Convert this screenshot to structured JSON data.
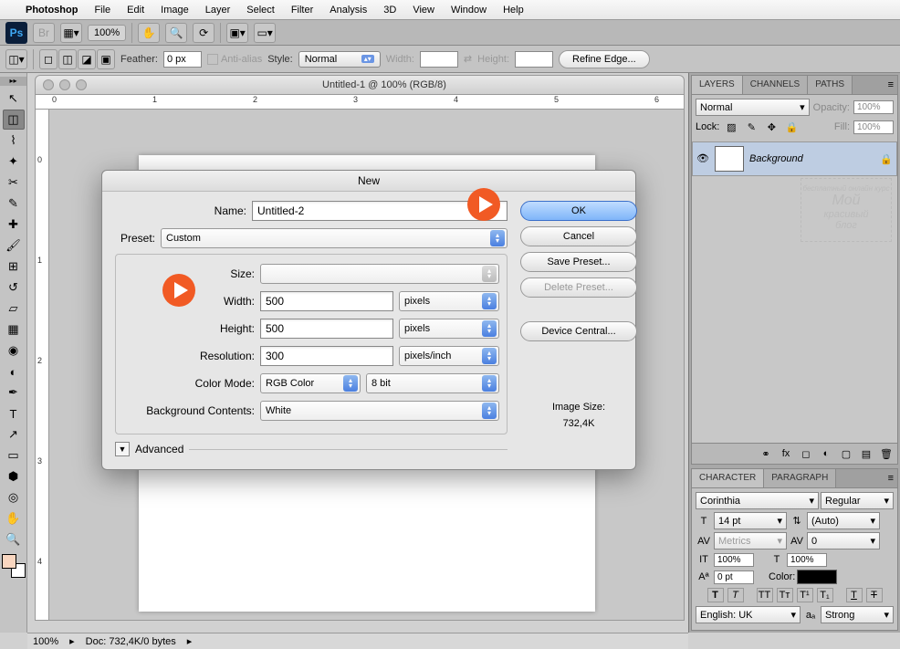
{
  "menubar": {
    "appname": "Photoshop",
    "items": [
      "File",
      "Edit",
      "Image",
      "Layer",
      "Select",
      "Filter",
      "Analysis",
      "3D",
      "View",
      "Window",
      "Help"
    ]
  },
  "optionsbar": {
    "zoom": "100%"
  },
  "optionsbar2": {
    "feather_label": "Feather:",
    "feather": "0 px",
    "antialias": "Anti-alias",
    "style_label": "Style:",
    "style": "Normal",
    "width_label": "Width:",
    "height_label": "Height:",
    "refine": "Refine Edge..."
  },
  "document": {
    "title": "Untitled-1 @ 100% (RGB/8)"
  },
  "dialog": {
    "title": "New",
    "name_label": "Name:",
    "name": "Untitled-2",
    "preset_label": "Preset:",
    "preset": "Custom",
    "size_label": "Size:",
    "width_label": "Width:",
    "width": "500",
    "width_unit": "pixels",
    "height_label": "Height:",
    "height": "500",
    "height_unit": "pixels",
    "resolution_label": "Resolution:",
    "resolution": "300",
    "resolution_unit": "pixels/inch",
    "colormode_label": "Color Mode:",
    "colormode": "RGB Color",
    "bitdepth": "8 bit",
    "bgcontents_label": "Background Contents:",
    "bgcontents": "White",
    "advanced": "Advanced",
    "ok": "OK",
    "cancel": "Cancel",
    "save_preset": "Save Preset...",
    "delete_preset": "Delete Preset...",
    "device_central": "Device Central...",
    "image_size_label": "Image Size:",
    "image_size": "732,4K"
  },
  "layers_panel": {
    "tabs": [
      "LAYERS",
      "CHANNELS",
      "PATHS"
    ],
    "blend": "Normal",
    "opacity_label": "Opacity:",
    "opacity": "100%",
    "lock_label": "Lock:",
    "fill_label": "Fill:",
    "fill": "100%",
    "layer_name": "Background"
  },
  "char_panel": {
    "tabs": [
      "CHARACTER",
      "PARAGRAPH"
    ],
    "font": "Corinthia",
    "weight": "Regular",
    "size": "14 pt",
    "leading": "(Auto)",
    "kerning": "Metrics",
    "tracking": "0",
    "vscale": "100%",
    "hscale": "100%",
    "baseline": "0 pt",
    "color_label": "Color:",
    "lang": "English: UK",
    "aa": "Strong"
  },
  "statusbar": {
    "zoom": "100%",
    "doc_label": "Doc:",
    "doc_info": "732,4K/0 bytes"
  },
  "watermark": {
    "line1": "бесплатный онлайн курс",
    "line2": "Мой",
    "line3": "красивый",
    "line4": "блог"
  }
}
